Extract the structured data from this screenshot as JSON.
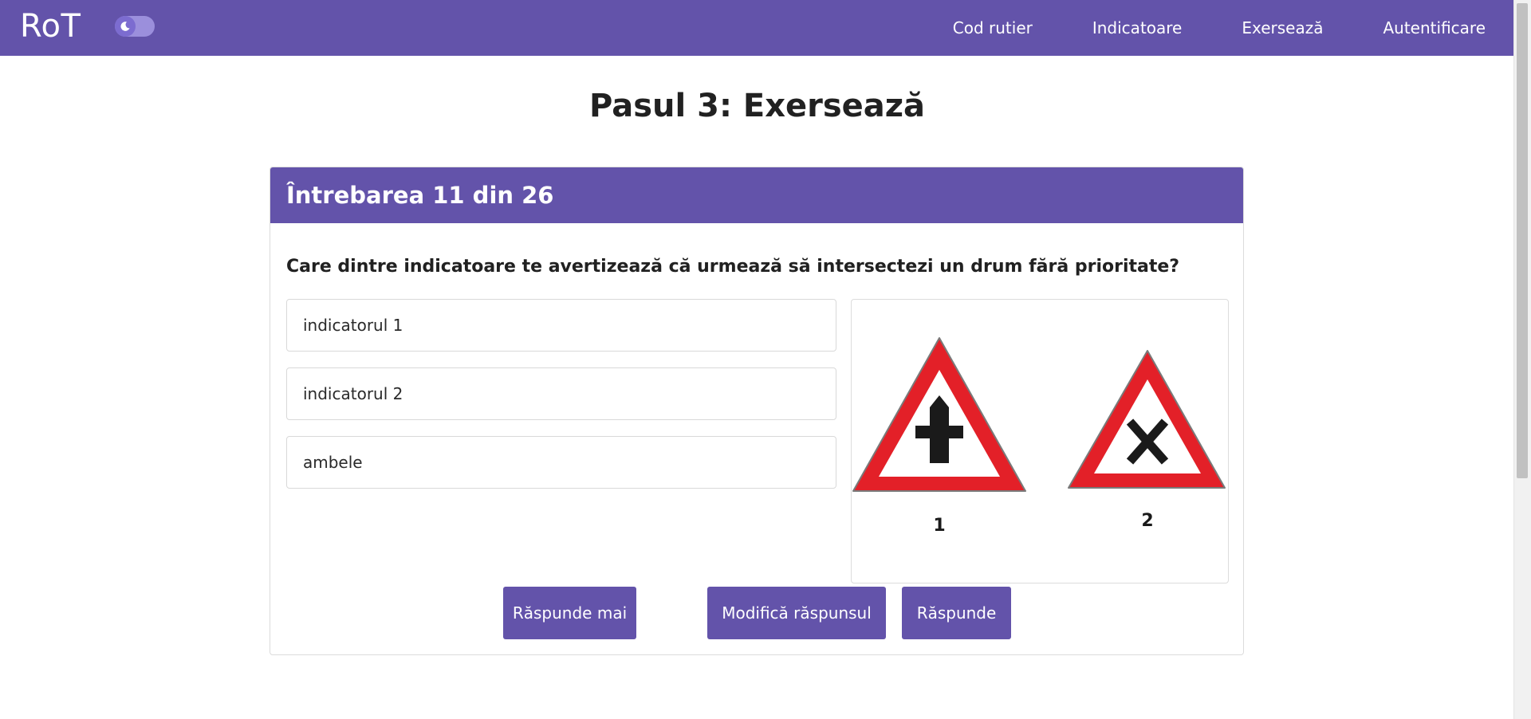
{
  "navbar": {
    "brand": "RoT",
    "toggle_icon": "moon-icon",
    "links": [
      "Cod rutier",
      "Indicatoare",
      "Exersează",
      "Autentificare"
    ]
  },
  "page": {
    "title": "Pasul 3: Exersează"
  },
  "quiz": {
    "header": "Întrebarea 11 din 26",
    "question": "Care dintre indicatoare te avertizează că urmează să intersectezi un drum fără prioritate?",
    "answers": [
      "indicatorul 1",
      "indicatorul 2",
      "ambele"
    ],
    "image": {
      "sign_1_label": "1",
      "sign_2_label": "2"
    },
    "buttons": {
      "later": "Răspunde mai târziu",
      "modify": "Modifică răspunsul",
      "submit": "Răspunde"
    }
  },
  "colors": {
    "primary": "#6353aa",
    "sign_red": "#e32028",
    "sign_symbol": "#1a1a1a"
  }
}
